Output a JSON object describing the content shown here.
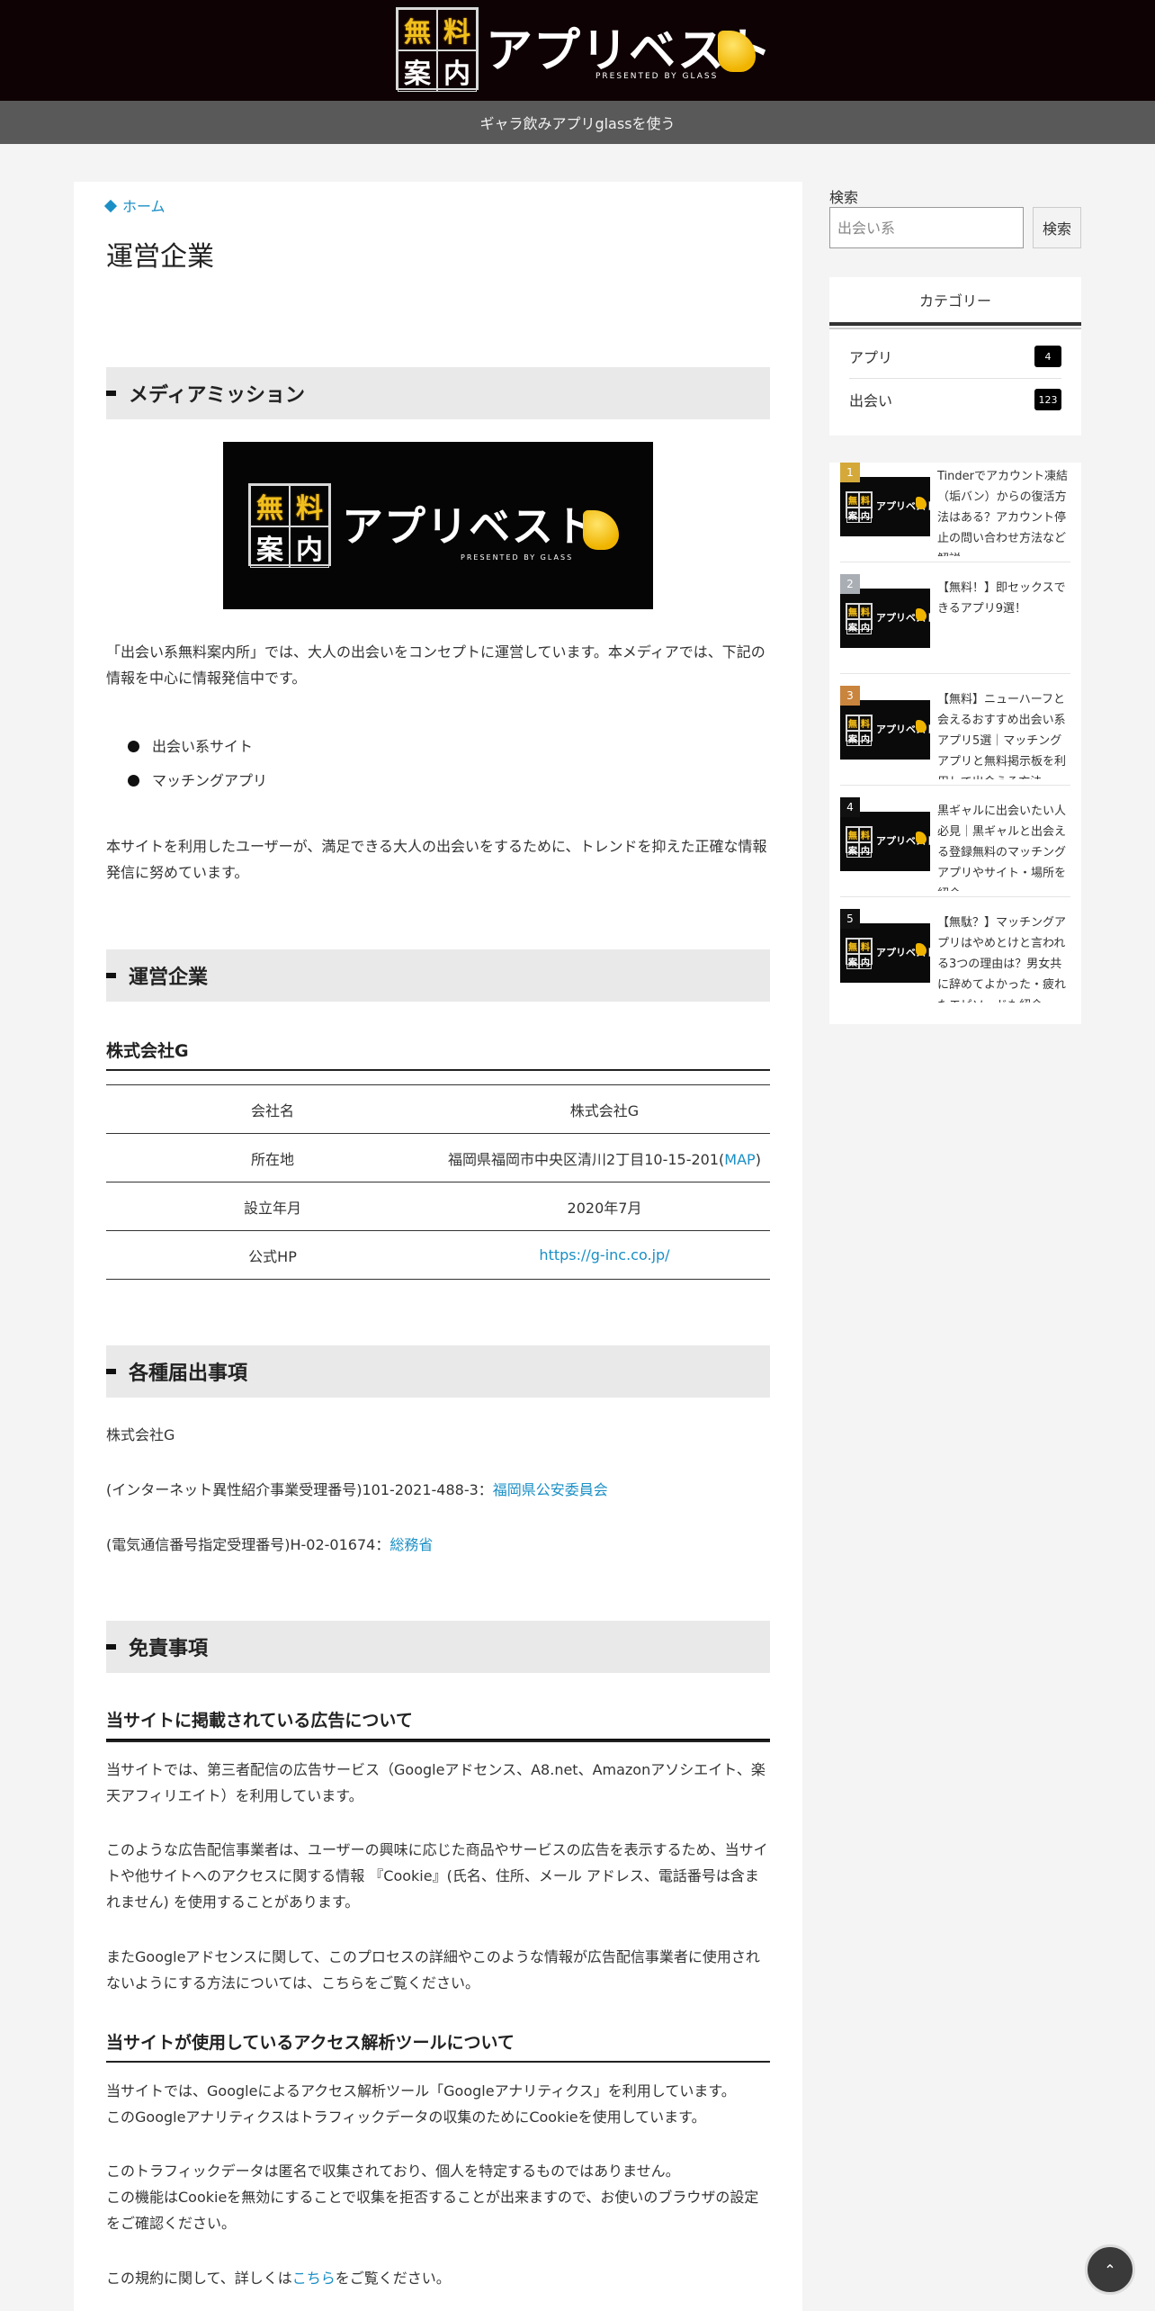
{
  "header": {
    "logo_kanji": [
      "無",
      "料",
      "案",
      "内"
    ],
    "logo_text": "アプリベスト",
    "logo_sub": "PRESENTED BY GLASS",
    "tagline": "ギャラ飲みアプリglassを使う"
  },
  "breadcrumb": {
    "home": "ホーム"
  },
  "page_title": "運営企業",
  "sections": {
    "mission": {
      "heading": "メディアミッション",
      "intro": "「出会い系無料案内所」では、大人の出会いをコンセプトに運営しています。本メディアでは、下記の情報を中心に情報発信中です。",
      "list": [
        "出会い系サイト",
        "マッチングアプリ"
      ],
      "outro": "本サイトを利用したユーザーが、満足できる大人の出会いをするために、トレンドを抑えた正確な情報発信に努めています。"
    },
    "company": {
      "heading": "運営企業",
      "subheading": "株式会社G",
      "table": [
        {
          "label": "会社名",
          "value": "株式会社G"
        },
        {
          "label": "所在地",
          "value": "福岡県福岡市中央区清川2丁目10-15-201(",
          "link": "MAP",
          "suffix": ")"
        },
        {
          "label": "設立年月",
          "value": "2020年7月"
        },
        {
          "label": "公式HP",
          "link": "https://g-inc.co.jp/"
        }
      ]
    },
    "notices": {
      "heading": "各種届出事項",
      "line1": "株式会社G",
      "line2_text": "(インターネット異性紹介事業受理番号)101-2021-488-3：",
      "line2_link": "福岡県公安委員会",
      "line3_text": "(電気通信番号指定受理番号)H-02-01674：",
      "line3_link": "総務省"
    },
    "disclaimer": {
      "heading": "免責事項",
      "ads_heading": "当サイトに掲載されている広告について",
      "ads_p1": "当サイトでは、第三者配信の広告サービス（Googleアドセンス、A8.net、Amazonアソシエイト、楽天アフィリエイト）を利用しています。",
      "ads_p2": "このような広告配信事業者は、ユーザーの興味に応じた商品やサービスの広告を表示するため、当サイトや他サイトへのアクセスに関する情報 『Cookie』(氏名、住所、メール アドレス、電話番号は含まれません) を使用することがあります。",
      "ads_p3": "またGoogleアドセンスに関して、このプロセスの詳細やこのような情報が広告配信事業者に使用されないようにする方法については、こちらをご覧ください。",
      "analytics_heading": "当サイトが使用しているアクセス解析ツールについて",
      "analytics_p1a": "当サイトでは、Googleによるアクセス解析ツール「Googleアナリティクス」を利用しています。",
      "analytics_p1b": "このGoogleアナリティクスはトラフィックデータの収集のためにCookieを使用しています。",
      "analytics_p2a": "このトラフィックデータは匿名で収集されており、個人を特定するものではありません。",
      "analytics_p2b": "この機能はCookieを無効にすることで収集を拒否することが出来ますので、お使いのブラウザの設定をご確認ください。",
      "analytics_p3a": "この規約に関して、詳しくは",
      "analytics_p3_link": "こちら",
      "analytics_p3b": "をご覧ください。"
    }
  },
  "sidebar": {
    "search_label": "検索",
    "search_placeholder": "出会い系",
    "search_button": "検索",
    "category_title": "カテゴリー",
    "categories": [
      {
        "name": "アプリ",
        "count": "4"
      },
      {
        "name": "出会い",
        "count": "123"
      }
    ],
    "ranking": [
      {
        "rank": "1",
        "title": "Tinderでアカウント凍結（垢バン）からの復活方法はある？アカウント停止の問い合わせ方法など解説"
      },
      {
        "rank": "2",
        "title": "【無料！】即セックスできるアプリ9選！"
      },
      {
        "rank": "3",
        "title": "【無料】ニューハーフと会えるおすすめ出会い系アプリ5選｜マッチングアプリと無料掲示板を利用して出会える方法"
      },
      {
        "rank": "4",
        "title": "黒ギャルに出会いたい人必見｜黒ギャルと出会える登録無料のマッチングアプリやサイト・場所を紹介"
      },
      {
        "rank": "5",
        "title": "【無駄？】マッチングアプリはやめとけと言われる3つの理由は？男女共に辞めてよかった・疲れたエピソードも紹介"
      }
    ],
    "thumb_text": "アプリベスト"
  },
  "colors": {
    "header_bg": "#0e0204",
    "subbar_bg": "#595959",
    "link": "#1a8fc5",
    "rank_gold": "#d4a93a",
    "rank_silver": "#a9aeb5",
    "rank_bronze": "#c9843d",
    "rank_default": "#111111"
  },
  "icons": {
    "breadcrumb": "diamond-icon",
    "back_to_top": "chevron-up-icon",
    "to_top_glyph": "⌃"
  }
}
